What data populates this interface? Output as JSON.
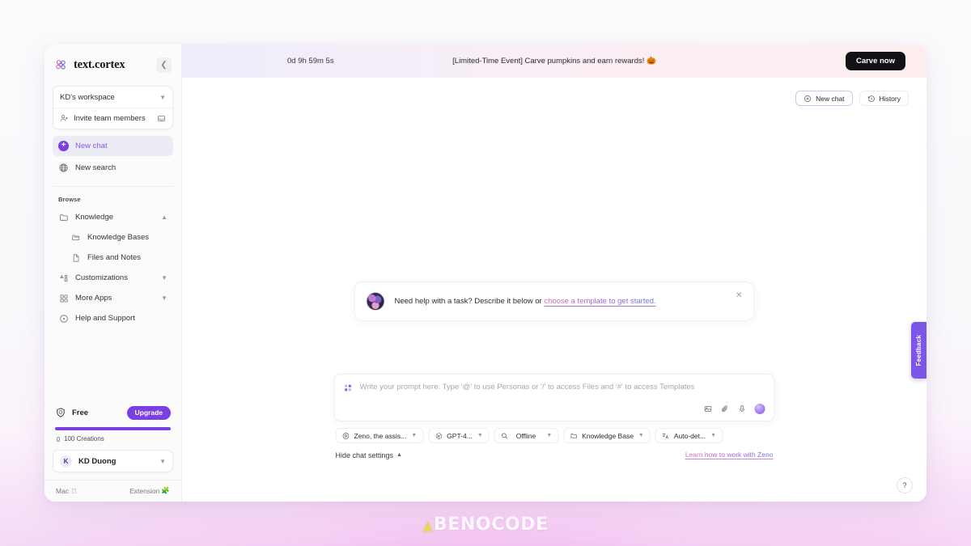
{
  "brand": {
    "name": "text.cortex",
    "logo_icon": "cortex-logo-icon",
    "collapse_icon": "chevron-left-icon"
  },
  "workspace": {
    "name": "KD's workspace",
    "chevron_icon": "chevron-down-icon"
  },
  "invite": {
    "label": "Invite team members",
    "icon": "user-plus-icon",
    "tail_icon": "inbox-icon"
  },
  "nav": [
    {
      "label": "New chat",
      "icon": "plus-circle-icon",
      "active": true
    },
    {
      "label": "New search",
      "icon": "globe-icon",
      "active": false
    }
  ],
  "browse": {
    "label": "Browse",
    "items": [
      {
        "label": "Knowledge",
        "icon": "folder-icon",
        "chevron": "chevron-up-icon",
        "sub": false
      },
      {
        "label": "Knowledge Bases",
        "icon": "folder-open-icon",
        "chevron": "",
        "sub": true
      },
      {
        "label": "Files and Notes",
        "icon": "file-icon",
        "chevron": "",
        "sub": true
      },
      {
        "label": "Customizations",
        "icon": "shapes-icon",
        "chevron": "chevron-down-icon",
        "sub": false
      },
      {
        "label": "More Apps",
        "icon": "grid-apps-icon",
        "chevron": "chevron-down-icon",
        "sub": false
      },
      {
        "label": "Help and Support",
        "icon": "help-circle-icon",
        "chevron": "",
        "sub": false
      }
    ]
  },
  "plan": {
    "name": "Free",
    "shield_icon": "shield-cortex-icon",
    "upgrade_label": "Upgrade",
    "progress_percent": 100,
    "usage_label": "100 Creations",
    "usage_icon": "coin-icon",
    "accent_color": "#7b3fe4"
  },
  "user": {
    "initial": "K",
    "name": "KD Duong",
    "chevron_icon": "chevron-down-icon"
  },
  "sidebar_footer": {
    "left_label": "Mac",
    "left_icon": "apple-icon",
    "right_label": "Extension",
    "right_icon": "puzzle-icon"
  },
  "promo": {
    "timer": "0d 9h 59m 5s",
    "message": "[Limited-Time Event] Carve pumpkins and earn rewards! 🎃",
    "cta_label": "Carve now"
  },
  "top_actions": [
    {
      "label": "New chat",
      "icon": "plus-circle-icon",
      "style": "primary"
    },
    {
      "label": "History",
      "icon": "history-icon",
      "style": "plain"
    }
  ],
  "helper_card": {
    "avatar_icon": "zeno-avatar",
    "text_before": "Need help with a task? Describe it below or ",
    "link_text": "choose a template to get started.",
    "close_icon": "close-icon"
  },
  "composer": {
    "leading_icon": "templates-grid-icon",
    "placeholder": "Write your prompt here. Type '@' to use Personas or '/' to access Files and '#' to access Templates",
    "tools": [
      {
        "name": "image-icon"
      },
      {
        "name": "attachment-icon"
      },
      {
        "name": "microphone-icon"
      },
      {
        "name": "send-orb-icon"
      }
    ],
    "settings_chips": [
      {
        "label": "Zeno, the assis...",
        "icon": "persona-icon",
        "chevron": "chevron-down-icon"
      },
      {
        "label": "GPT-4...",
        "icon": "openai-icon",
        "chevron": "chevron-down-icon"
      },
      {
        "label": "Offline",
        "icon": "search-icon",
        "chevron": "chevron-down-icon"
      },
      {
        "label": "Knowledge Base",
        "icon": "folder-icon",
        "chevron": "chevron-down-icon"
      },
      {
        "label": "Auto-det...",
        "icon": "language-icon",
        "chevron": "chevron-down-icon"
      }
    ],
    "hide_settings_label": "Hide chat settings",
    "hide_settings_icon": "chevron-up-icon",
    "learn_link": "Learn how to work with Zeno"
  },
  "feedback_tab": {
    "label": "Feedback",
    "color": "#7b56e8"
  },
  "help_fab": {
    "label": "?"
  },
  "watermark": {
    "mark": "▲",
    "text": "BENOCODE"
  }
}
